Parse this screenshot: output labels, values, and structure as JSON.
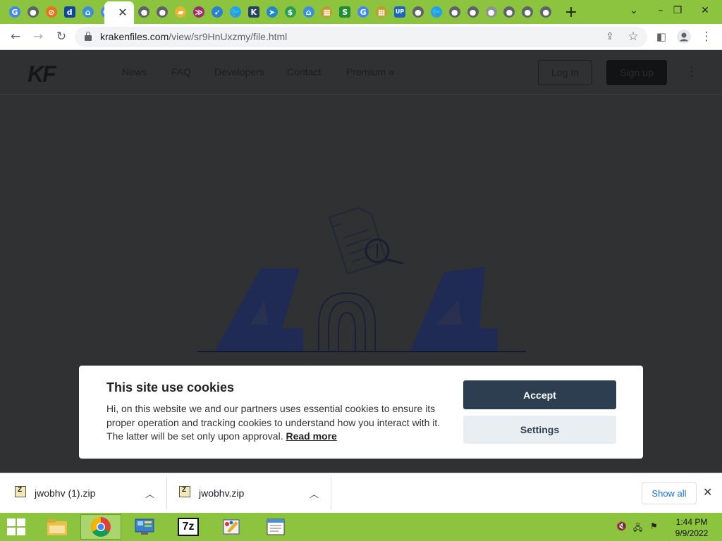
{
  "browser": {
    "tabs": [
      {
        "name": "google-favicon",
        "glyph": "G",
        "color": "#4285f4"
      },
      {
        "name": "globe-favicon",
        "glyph": "●",
        "color": "#5f6368"
      },
      {
        "name": "compass-favicon",
        "glyph": "⊘",
        "color": "#e8711c"
      },
      {
        "name": "d-favicon",
        "glyph": "d",
        "color": "#0d47a1"
      },
      {
        "name": "house-favicon",
        "glyph": "⌂",
        "color": "#3b8fd8"
      },
      {
        "name": "google-favicon",
        "glyph": "G",
        "color": "#4285f4"
      },
      {
        "name": "globe-favicon",
        "glyph": "●",
        "color": "#5f6368"
      },
      {
        "name": "globe-favicon",
        "glyph": "●",
        "color": "#5f6368"
      },
      {
        "name": "folder-favicon",
        "glyph": "▰",
        "color": "#e4b535"
      },
      {
        "name": "chevron-favicon",
        "glyph": "≫",
        "color": "#9c2c6a"
      },
      {
        "name": "rocket-favicon",
        "glyph": "➶",
        "color": "#2a7fd0"
      },
      {
        "name": "twitter-favicon",
        "glyph": "🐦",
        "color": "#1da1f2"
      },
      {
        "name": "kf-favicon",
        "glyph": "K",
        "color": "#26445f"
      },
      {
        "name": "telegram-favicon",
        "glyph": "➤",
        "color": "#1f88cc"
      },
      {
        "name": "dollar-favicon",
        "glyph": "$",
        "color": "#2aa14a"
      },
      {
        "name": "house-favicon",
        "glyph": "⌂",
        "color": "#3b8fd8"
      },
      {
        "name": "archive-favicon",
        "glyph": "▦",
        "color": "#c39a2c"
      },
      {
        "name": "s-favicon",
        "glyph": "S",
        "color": "#1e8d3a"
      },
      {
        "name": "google-favicon",
        "glyph": "G",
        "color": "#4285f4"
      },
      {
        "name": "archive-favicon",
        "glyph": "▦",
        "color": "#c39a2c"
      },
      {
        "name": "up-favicon",
        "glyph": "UP",
        "color": "#1c64c4"
      },
      {
        "name": "globe-favicon",
        "glyph": "●",
        "color": "#5f6368"
      },
      {
        "name": "twitter-favicon",
        "glyph": "🐦",
        "color": "#1da1f2"
      },
      {
        "name": "globe-favicon",
        "glyph": "●",
        "color": "#5f6368"
      },
      {
        "name": "globe-favicon",
        "glyph": "●",
        "color": "#5f6368"
      },
      {
        "name": "globe-favicon",
        "glyph": "●",
        "color": "#8e9398"
      },
      {
        "name": "globe-favicon",
        "glyph": "●",
        "color": "#5f6368"
      },
      {
        "name": "globe-favicon",
        "glyph": "●",
        "color": "#5f6368"
      },
      {
        "name": "globe-favicon",
        "glyph": "●",
        "color": "#5f6368"
      }
    ],
    "url_host": "krakenfiles.com",
    "url_path": "/view/sr9HnUxzmy/file.html"
  },
  "site": {
    "logo": "KF",
    "nav": [
      "News",
      "FAQ",
      "Developers",
      "Contact",
      "Premium"
    ],
    "login": "Log In",
    "signup": "Sign up"
  },
  "cookie": {
    "title": "This site use cookies",
    "text": "Hi, on this website we and our partners uses essential cookies to ensure its proper operation and tracking cookies to understand how you interact with it. The latter will be set only upon approval.",
    "read_more": "Read more",
    "accept": "Accept",
    "settings": "Settings"
  },
  "downloads": {
    "items": [
      "jwobhv (1).zip",
      "jwobhv.zip"
    ],
    "show_all": "Show all"
  },
  "taskbar": {
    "apps": [
      "file-explorer",
      "chrome",
      "control-panel",
      "7zip",
      "paint",
      "notepad"
    ],
    "time": "1:44 PM",
    "date": "9/9/2022"
  },
  "colors": {
    "chrome_frame": "#8dc43f",
    "overlay": "#2f3133",
    "accept": "#2c3e50",
    "illustration": "#1f2a55"
  }
}
